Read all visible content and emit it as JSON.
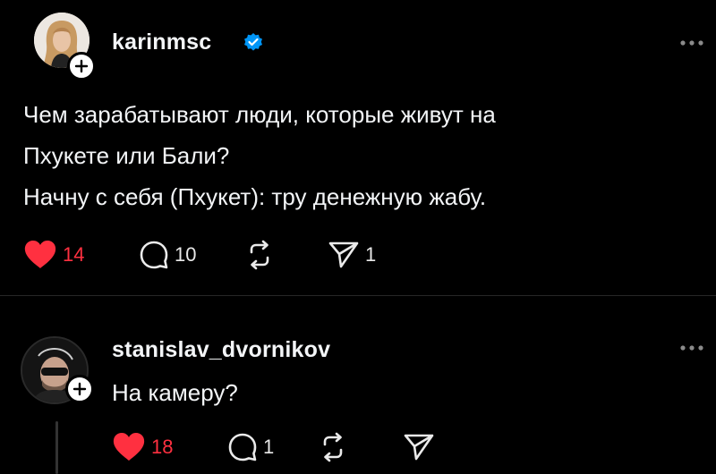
{
  "posts": [
    {
      "username": "karinmsc",
      "verified": true,
      "lines": [
        "Чем зарабатывают люди, которые живут на",
        "Пхукете или Бали?",
        "Начну с себя (Пхукет): тру денежную жабу."
      ],
      "likes": "14",
      "liked": true,
      "replies": "10",
      "reposts": "",
      "shares": "1"
    },
    {
      "username": "stanislav_dvornikov",
      "verified": false,
      "lines": [
        "На камеру?"
      ],
      "likes": "18",
      "liked": true,
      "replies": "1",
      "reposts": "",
      "shares": ""
    }
  ],
  "colors": {
    "background": "#000000",
    "text": "#f3f5f7",
    "like_red": "#ff3040",
    "verified_blue": "#0095f6",
    "divider": "#262626"
  },
  "icons": [
    "heart-icon",
    "comment-icon",
    "repost-icon",
    "share-icon",
    "more-icon",
    "verified-badge-icon",
    "plus-icon"
  ]
}
